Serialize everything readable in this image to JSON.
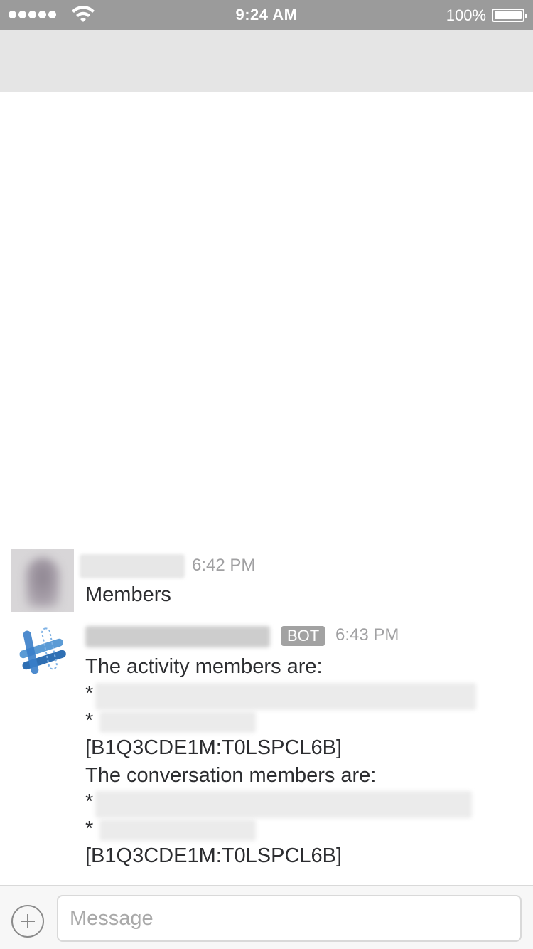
{
  "status_bar": {
    "time": "9:24 AM",
    "battery_percent": "100%",
    "signal_icon": "signal-dots-icon",
    "wifi_icon": "wifi-icon",
    "battery_icon": "battery-icon",
    "battery_level": 1.0
  },
  "messages": [
    {
      "timestamp": "6:42 PM",
      "text": "Members"
    },
    {
      "badge": "BOT",
      "timestamp": "6:43 PM",
      "line1": "The activity members are:",
      "bullet1": "*",
      "bullet2": "*",
      "id1": "[B1Q3CDE1M:T0LSPCL6B]",
      "line2": "The conversation members are:",
      "bullet3": "*",
      "bullet4": "*",
      "id2": "[B1Q3CDE1M:T0LSPCL6B]"
    }
  ],
  "composer": {
    "placeholder": "Message",
    "add_icon": "plus-circle-icon"
  },
  "colors": {
    "status_bar": "#9b9b9b",
    "nav_bar": "#e5e5e5",
    "text": "#2c2d30",
    "muted": "#a0a0a2",
    "bot_badge": "#a2a2a2"
  }
}
